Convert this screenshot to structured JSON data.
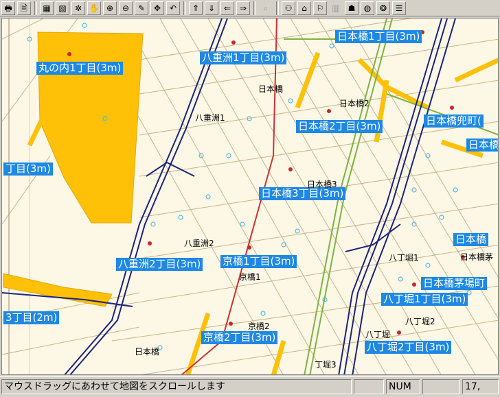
{
  "toolbar": {
    "buttons": [
      {
        "name": "print-icon",
        "glyph": "🖶"
      },
      {
        "name": "page-icon",
        "glyph": "🗎"
      },
      {
        "name": "layer-icon",
        "glyph": "▦"
      },
      {
        "name": "layer-zoom-icon",
        "glyph": "▧"
      },
      {
        "name": "sparkle-icon",
        "glyph": "✲"
      },
      {
        "name": "hand-icon",
        "glyph": "✋"
      },
      {
        "name": "zoom-in-icon",
        "glyph": "⊕"
      },
      {
        "name": "zoom-out-icon",
        "glyph": "⊖"
      },
      {
        "name": "pen-icon",
        "glyph": "✎"
      },
      {
        "name": "move-icon",
        "glyph": "✥"
      },
      {
        "name": "undo-icon",
        "glyph": "↶"
      },
      {
        "name": "arrow-up-icon",
        "glyph": "⇑"
      },
      {
        "name": "arrow-down-icon",
        "glyph": "⇓"
      },
      {
        "name": "arrow-left-icon",
        "glyph": "⇐"
      },
      {
        "name": "arrow-right-icon",
        "glyph": "⇒"
      },
      {
        "name": "search-icon",
        "glyph": "⌕",
        "disabled": true
      },
      {
        "name": "people-icon",
        "glyph": "⚇"
      },
      {
        "name": "home-icon",
        "glyph": "⌂"
      },
      {
        "name": "flag-icon",
        "glyph": "⚐"
      },
      {
        "name": "building-icon",
        "glyph": "▥",
        "disabled": true
      },
      {
        "name": "shop-icon",
        "glyph": "☗"
      },
      {
        "name": "globe-icon",
        "glyph": "◍"
      },
      {
        "name": "palette-icon",
        "glyph": "❂"
      },
      {
        "name": "settings-icon",
        "glyph": "☰"
      }
    ]
  },
  "map": {
    "area_labels": [
      "日本橋1丁目(3m)",
      "八重洲1丁目(3m)",
      "丸の内1丁目(3m)",
      "日本橋2丁目(3m)",
      "日本橋兜町(",
      "日本橋",
      "丁目(3m)",
      "日本橋3丁目(3m)",
      "日本橋",
      "八重洲2丁目(3m)",
      "京橋1丁目(3m)",
      "日本橋茅場町",
      "八丁堀1丁目(3m)",
      "3丁目(2m)",
      "京橋2丁目(3m)",
      "八丁堀2丁目(3m)"
    ],
    "place_labels": [
      "日本橋",
      "日本橋2",
      "八重洲1",
      "日本橋3",
      "八重洲2",
      "京橋1",
      "京橋2",
      "八丁堀1",
      "日本橋茅",
      "八丁堀2",
      "八丁堀",
      "日本橋",
      "丁堀3"
    ],
    "colors": {
      "background": "#fdf7e6",
      "road_yellow": "#ffc107",
      "road_line": "#c9b38a",
      "highway": "#1a237e",
      "rail_red": "#d32f2f",
      "rail_green": "#7cb342",
      "label_bg": "#1e88e5",
      "poi": "#5bb7d8"
    }
  },
  "status": {
    "message": "マウスドラッグにあわせて地図をスクロールします",
    "num": "NUM",
    "coord": "17,"
  }
}
